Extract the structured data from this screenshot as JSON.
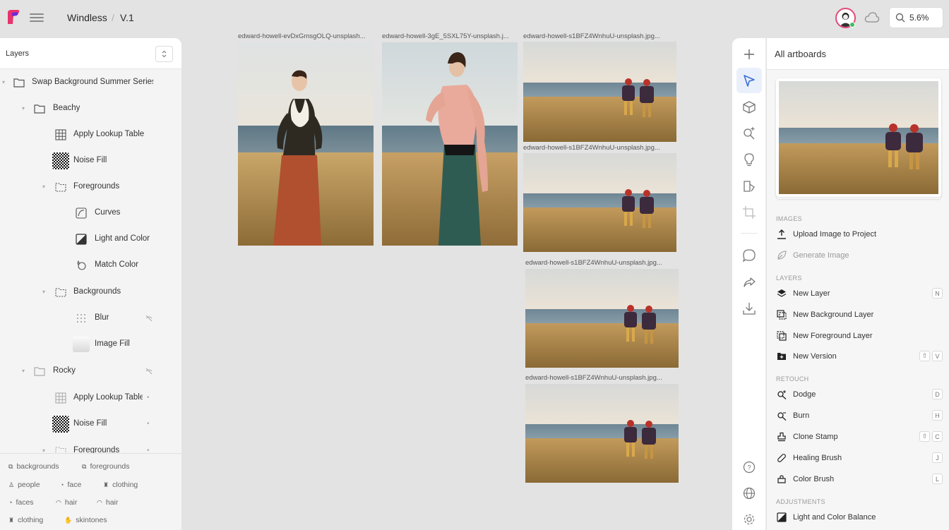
{
  "topbar": {
    "title": "Windless",
    "separator": "/",
    "version": "V.1",
    "zoom": "5.6%"
  },
  "layers_panel": {
    "title": "Layers",
    "items": [
      {
        "label": "Swap Background Summer Series",
        "icon": "folder-icon"
      },
      {
        "label": "Beachy",
        "icon": "folder-icon"
      },
      {
        "label": "Apply Lookup Table",
        "icon": "grid-icon"
      },
      {
        "label": "Noise Fill",
        "icon": "noise-icon"
      },
      {
        "label": "Foregrounds",
        "icon": "dashed-folder-icon"
      },
      {
        "label": "Curves",
        "icon": "curves-icon"
      },
      {
        "label": "Light and Color",
        "icon": "light-color-icon"
      },
      {
        "label": "Match Color",
        "icon": "match-color-icon"
      },
      {
        "label": "Backgrounds",
        "icon": "dashed-folder-icon"
      },
      {
        "label": "Blur",
        "icon": "blur-icon"
      },
      {
        "label": "Image Fill",
        "icon": "image-fill-icon"
      },
      {
        "label": "Rocky",
        "icon": "folder-icon"
      },
      {
        "label": "Apply Lookup Table",
        "icon": "grid-icon"
      },
      {
        "label": "Noise Fill",
        "icon": "noise-icon"
      },
      {
        "label": "Foregrounds",
        "icon": "dashed-folder-icon"
      }
    ],
    "tags": [
      {
        "label": "backgrounds"
      },
      {
        "label": "foregrounds"
      },
      {
        "label": "people"
      },
      {
        "label": "face"
      },
      {
        "label": "clothing"
      },
      {
        "label": "faces"
      },
      {
        "label": "hair"
      },
      {
        "label": "hair"
      },
      {
        "label": "clothing"
      },
      {
        "label": "skintones"
      }
    ]
  },
  "canvas": {
    "artboards": [
      {
        "label": "edward-howell-evDxGmsgOLQ-unsplash..."
      },
      {
        "label": "edward-howell-3gE_5SXL75Y-unsplash.j..."
      },
      {
        "label": "edward-howell-s1BFZ4WnhuU-unsplash.jpg..."
      },
      {
        "label": "edward-howell-s1BFZ4WnhuU-unsplash.jpg..."
      },
      {
        "label": "edward-howell-s1BFZ4WnhuU-unsplash.jpg..."
      },
      {
        "label": "edward-howell-s1BFZ4WnhuU-unsplash.jpg..."
      }
    ]
  },
  "right_panel": {
    "title": "All artboards",
    "sections": {
      "images": "IMAGES",
      "layers": "LAYERS",
      "retouch": "RETOUCH",
      "adjustments": "ADJUSTMENTS"
    },
    "images_actions": [
      {
        "label": "Upload Image to Project"
      },
      {
        "label": "Generate Image"
      }
    ],
    "layers_actions": [
      {
        "label": "New Layer",
        "shortcut": "N"
      },
      {
        "label": "New Background Layer"
      },
      {
        "label": "New Foreground Layer"
      },
      {
        "label": "New Version",
        "shortcut_mod": "⇧",
        "shortcut": "V"
      }
    ],
    "retouch_actions": [
      {
        "label": "Dodge",
        "shortcut": "D"
      },
      {
        "label": "Burn",
        "shortcut": "H"
      },
      {
        "label": "Clone Stamp",
        "shortcut_mod": "⇧",
        "shortcut": "C"
      },
      {
        "label": "Healing Brush",
        "shortcut": "J"
      },
      {
        "label": "Color Brush",
        "shortcut": "L"
      }
    ],
    "adjustments_actions": [
      {
        "label": "Light and Color Balance"
      }
    ]
  },
  "colors": {
    "accent": "#3b6fd8",
    "avatar_ring": "#e24a7a",
    "online": "#3bbf5c"
  }
}
